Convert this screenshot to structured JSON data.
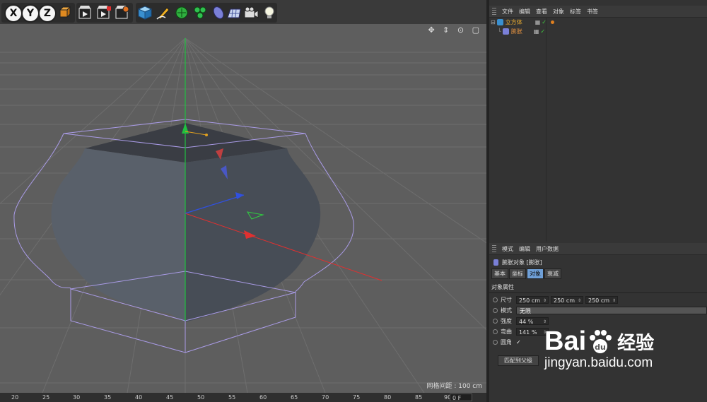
{
  "toolbar": {
    "axis_x": "X",
    "axis_y": "Y",
    "axis_z": "Z"
  },
  "viewport": {
    "grid_distance": "网格间距 : 100 cm",
    "nav_icons": "✥ ⇕ ⊙ ▢"
  },
  "timeline": {
    "ticks": [
      "20",
      "25",
      "30",
      "35",
      "40",
      "45",
      "50",
      "55",
      "60",
      "65",
      "70",
      "75",
      "80",
      "85",
      "90"
    ],
    "frame_value": "0 F"
  },
  "object_manager": {
    "menu": [
      "文件",
      "编辑",
      "查看",
      "对象",
      "标签",
      "书签"
    ],
    "objects": [
      {
        "name": "立方体",
        "color": "#f0b030"
      },
      {
        "name": "膨胀",
        "color": "#e09040"
      }
    ]
  },
  "attributes": {
    "menu": [
      "模式",
      "编辑",
      "用户数据"
    ],
    "title": "膨胀对象 [膨胀]",
    "tabs": [
      "基本",
      "坐标",
      "对象",
      "衰减"
    ],
    "active_tab": 2,
    "section": "对象属性",
    "size_label": "尺寸",
    "size_values": [
      "250 cm",
      "250 cm",
      "250 cm"
    ],
    "mode_label": "模式",
    "mode_value": "无限",
    "strength_label": "强度",
    "strength_value": "44 %",
    "curvature_label": "弯曲",
    "curvature_value": "141 %",
    "round_label": "圆角",
    "round_checked": "✓",
    "fit_button": "匹配到父级"
  },
  "watermark": {
    "brand": "Bai",
    "brand2": "经验",
    "url": "jingyan.baidu.com"
  },
  "colors": {
    "accent": "#6fa0d8",
    "x_axis": "#e03030",
    "y_axis": "#20c040",
    "z_axis": "#3050e0",
    "bbox": "#a99be6",
    "object": "#4a505a"
  }
}
